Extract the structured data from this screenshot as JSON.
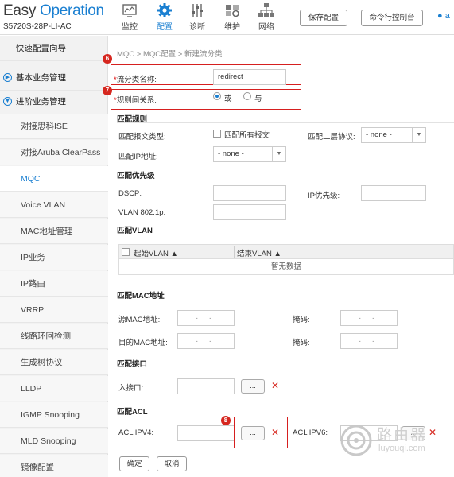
{
  "brand": {
    "logo_easy": "Easy",
    "logo_operation": "Operation",
    "model": "S5720S-28P-LI-AC"
  },
  "nav": [
    {
      "label": "监控",
      "icon": "monitor-icon"
    },
    {
      "label": "配置",
      "icon": "gear-icon",
      "active": true
    },
    {
      "label": "诊断",
      "icon": "sliders-icon"
    },
    {
      "label": "维护",
      "icon": "maintenance-icon"
    },
    {
      "label": "网络",
      "icon": "network-icon"
    }
  ],
  "header_buttons": {
    "save": "保存配置",
    "cli": "命令行控制台"
  },
  "user": {
    "initial": "a"
  },
  "sidebar": {
    "items": [
      {
        "label": "快速配置向导"
      },
      {
        "label": "基本业务管理"
      },
      {
        "label": "进阶业务管理"
      },
      {
        "label": "对接思科ISE"
      },
      {
        "label": "对接Aruba ClearPass"
      },
      {
        "label": "MQC"
      },
      {
        "label": "Voice VLAN"
      },
      {
        "label": "MAC地址管理"
      },
      {
        "label": "IP业务"
      },
      {
        "label": "IP路由"
      },
      {
        "label": "VRRP"
      },
      {
        "label": "线路环回检测"
      },
      {
        "label": "生成树协议"
      },
      {
        "label": "LLDP"
      },
      {
        "label": "IGMP Snooping"
      },
      {
        "label": "MLD Snooping"
      },
      {
        "label": "镜像配置"
      }
    ]
  },
  "breadcrumb": "MQC > MQC配置 > 新建流分类",
  "form": {
    "req_mark": "*",
    "class_name_label": "流分类名称:",
    "class_name_value": "redirect",
    "rule_label": "规则间关系:",
    "rule_or": "或",
    "rule_and": "与",
    "match_rules_title": "匹配规则",
    "packet_type_label": "匹配报文类型:",
    "match_all_label": "匹配所有报文",
    "l2_proto_label": "匹配二层协议:",
    "l2_proto_value": "- none -",
    "ip_addr_label": "匹配IP地址:",
    "ip_addr_value": "- none -",
    "priority_title": "匹配优先级",
    "dscp_label": "DSCP:",
    "ip_prio_label": "IP优先级:",
    "vlan8021p_label": "VLAN 802.1p:",
    "vlan_title": "匹配VLAN",
    "start_vlan_col": "起始VLAN ▲",
    "end_vlan_col": "结束VLAN ▲",
    "no_data": "暂无数据",
    "mac_title": "匹配MAC地址",
    "src_mac_label": "源MAC地址:",
    "dst_mac_label": "目的MAC地址:",
    "mask_label": "掩码:",
    "mac_placeholder": "- -",
    "iface_title": "匹配接口",
    "in_iface_label": "入接口:",
    "acl_title": "匹配ACL",
    "acl_ipv4_label": "ACL IPV4:",
    "acl_ipv6_label": "ACL IPV6:",
    "browse": "...",
    "remove": "✕"
  },
  "callouts": {
    "six": "6",
    "seven": "7",
    "eight": "8"
  },
  "actions": {
    "ok": "确定",
    "cancel": "取消"
  },
  "watermark": {
    "cn": "路由器",
    "en": "luyouqi.com"
  },
  "colors": {
    "accent": "#1a7fd1",
    "callout": "#d6271f"
  }
}
